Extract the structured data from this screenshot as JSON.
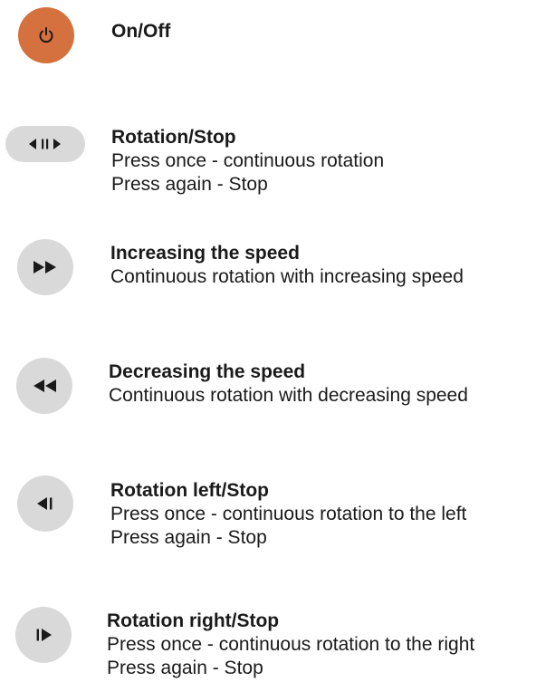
{
  "items": [
    {
      "icon": "power-icon",
      "title": "On/Off",
      "lines": []
    },
    {
      "icon": "rotation-stop-icon",
      "title": "Rotation/Stop",
      "lines": [
        "Press once - continuous rotation",
        "Press again - Stop"
      ]
    },
    {
      "icon": "fast-forward-icon",
      "title": "Increasing the speed",
      "lines": [
        "Continuous rotation with increasing speed"
      ]
    },
    {
      "icon": "rewind-icon",
      "title": "Decreasing the speed",
      "lines": [
        "Continuous rotation with decreasing speed"
      ]
    },
    {
      "icon": "rotate-left-icon",
      "title": "Rotation left/Stop",
      "lines": [
        "Press once - continuous rotation to the left",
        "Press again - Stop"
      ]
    },
    {
      "icon": "rotate-right-icon",
      "title": "Rotation right/Stop",
      "lines": [
        "Press once - continuous rotation to the right",
        "Press again - Stop"
      ]
    }
  ],
  "colors": {
    "power_button": "#d4713f",
    "button_grey": "#d9d9d9",
    "icon_dark": "#1a1a1a"
  }
}
